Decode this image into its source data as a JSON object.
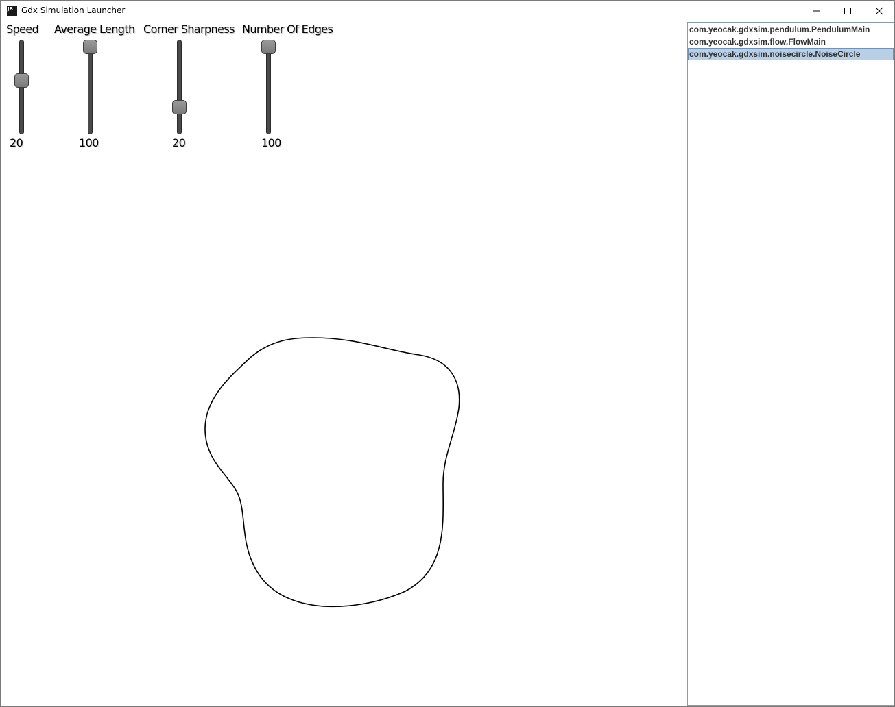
{
  "window": {
    "title": "Gdx Simulation Launcher",
    "icon_text": "JB",
    "controls": [
      "minimize-icon",
      "maximize-icon",
      "close-icon"
    ]
  },
  "sliders": [
    {
      "label": "Speed",
      "value": "20",
      "level": 0.58
    },
    {
      "label": "Average Length",
      "value": "100",
      "level": 1.0
    },
    {
      "label": "Corner Sharpness",
      "value": "20",
      "level": 0.25
    },
    {
      "label": "Number Of Edges",
      "value": "100",
      "level": 1.0
    }
  ],
  "simulation_list": {
    "items": [
      "com.yeocak.gdxsim.pendulum.PendulumMain",
      "com.yeocak.gdxsim.flow.FlowMain",
      "com.yeocak.gdxsim.noisecircle.NoiseCircle"
    ],
    "selected": "com.yeocak.gdxsim.noisecircle.NoiseCircle"
  },
  "colors": {
    "selection_bg": "#b8cfe5",
    "selection_border": "#6f93b8",
    "slider_track": "#4a4a4a",
    "slider_knob": "#8a8a8a",
    "shape_stroke": "#000000"
  }
}
